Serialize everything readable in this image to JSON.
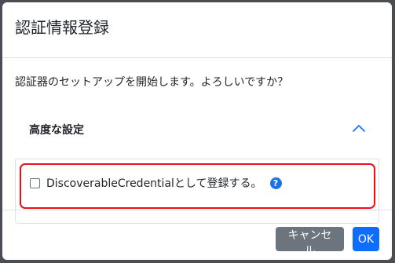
{
  "modal": {
    "title": "認証情報登録",
    "message": "認証器のセットアップを開始します。よろしいですか？"
  },
  "advanced": {
    "header": "高度な設定",
    "expanded": true,
    "checkbox_label": "DiscoverableCredentialとして登録する。",
    "checkbox_checked": false,
    "help_glyph": "?"
  },
  "footer": {
    "cancel_label": "キャンセル",
    "ok_label": "OK"
  },
  "colors": {
    "primary": "#0d6efd",
    "secondary": "#6c757d",
    "highlight": "#e8101a",
    "help": "#1a73e8"
  }
}
